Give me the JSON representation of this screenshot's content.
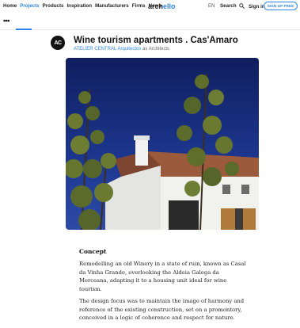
{
  "nav": {
    "links": [
      "Home",
      "Projects",
      "Products",
      "Inspiration",
      "Manufacturers",
      "Firms",
      "News"
    ],
    "active": "Projects"
  },
  "logo": {
    "part1": "arch",
    "part2": "ello"
  },
  "utility": {
    "lang": "EN",
    "search": "Search",
    "signin": "Sign in",
    "signup": "SIGN UP FREE"
  },
  "subbar": {
    "more": "•••"
  },
  "project": {
    "avatar": "AC",
    "title": "Wine tourism apartments . Cas'Amaro",
    "firm": "ATELIER CENTRAL Arquitectos",
    "role": " as Architects"
  },
  "article": {
    "heading": "Concept",
    "paragraphs": [
      "Remodelling an old Winery in a state of ruin, known as Casal da Vinha Grande, overlooking the Aldeia Galega da Merceana, adapting it to a housing unit ideal for wine tourism.",
      "The design focus was to maintain the image of harmony and reference of the existing construction, set on a promontory, conceived in a logic of coherence and respect for nature."
    ]
  },
  "colors": {
    "accent": "#2f86e6",
    "sky": "#1c2f7a"
  },
  "icons": {
    "search": "magnifier-icon"
  }
}
